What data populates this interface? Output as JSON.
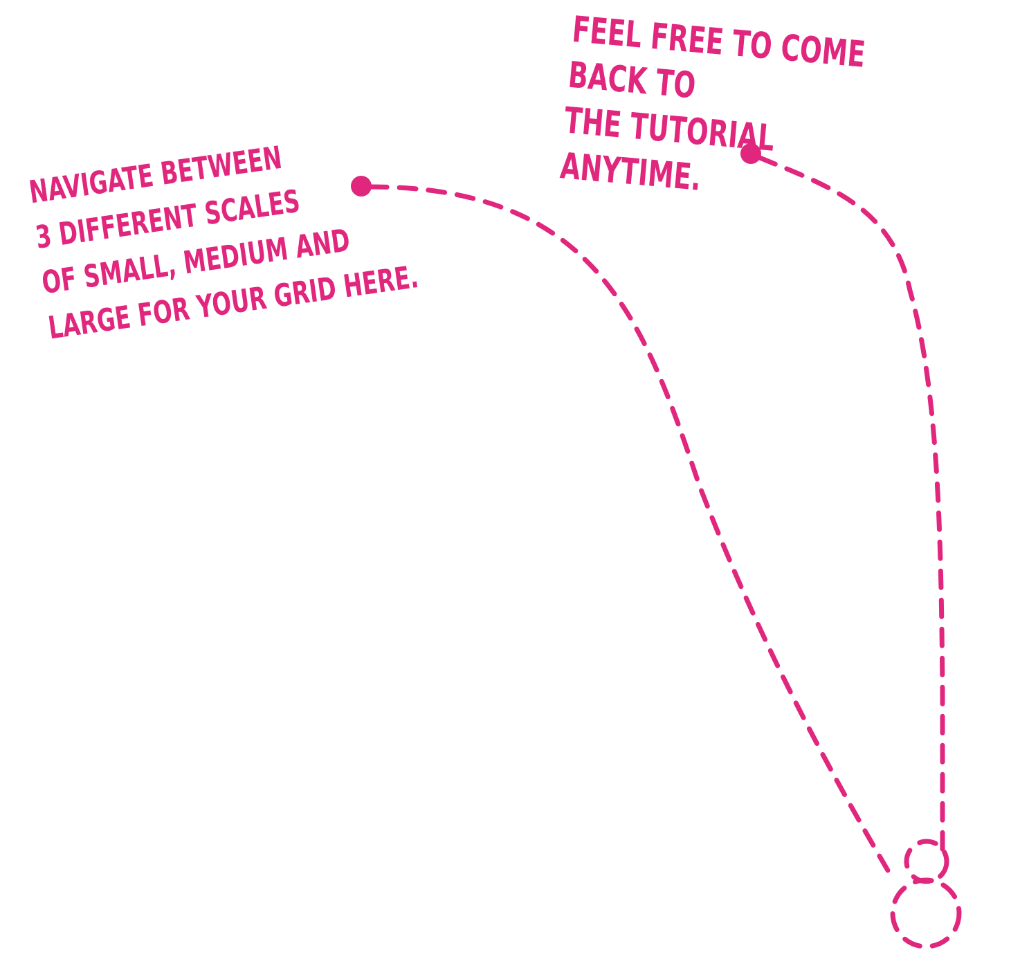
{
  "accent_color": "#e0267d",
  "tooltips": {
    "scales": "NAVIGATE BETWEEN\n3 DIFFERENT SCALES\nOF SMALL, MEDIUM AND\nLARGE FOR YOUR GRID HERE.",
    "tutorial": "FEEL FREE TO COME BACK TO\nTHE TUTORIAL ANYTIME."
  }
}
